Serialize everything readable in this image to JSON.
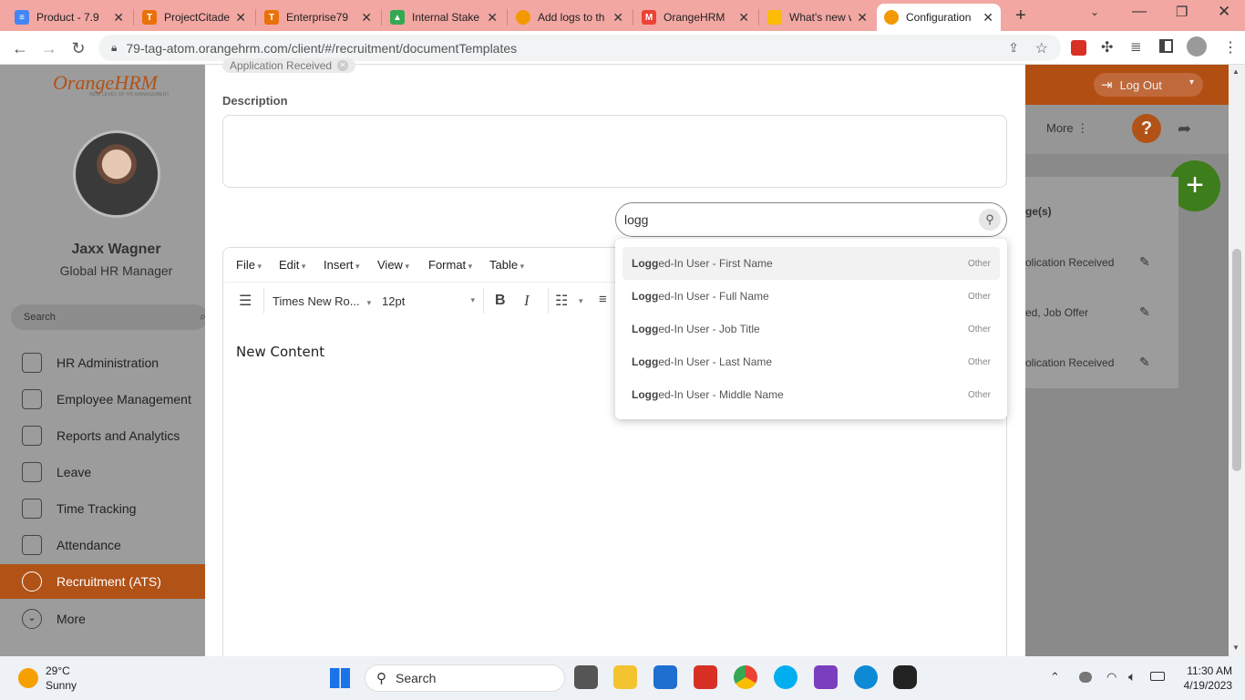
{
  "browser": {
    "tabs": [
      {
        "title": "Product - 7.9",
        "color": "#4285f4",
        "glyph": "≡"
      },
      {
        "title": "ProjectCitade",
        "color": "#e8710a",
        "glyph": "T"
      },
      {
        "title": "Enterprise79",
        "color": "#e8710a",
        "glyph": "T"
      },
      {
        "title": "Internal Stake",
        "color": "#34a853",
        "glyph": "▲"
      },
      {
        "title": "Add logs to th",
        "color": "#f29900",
        "glyph": "●"
      },
      {
        "title": "OrangeHRM",
        "color": "#ea4335",
        "glyph": "M"
      },
      {
        "title": "What's new w",
        "color": "#fbbc04",
        "glyph": "▭"
      },
      {
        "title": "Configuration",
        "color": "#f29900",
        "glyph": "●"
      }
    ],
    "new_tab_symbol": "+",
    "url": "79-tag-atom.orangehrm.com/client/#/recruitment/documentTemplates"
  },
  "sidebar": {
    "logo_text": "OrangeHRM",
    "logo_tagline": "NEW LEVEL OF HR MANAGEMENT",
    "user_name": "Jaxx Wagner",
    "user_role": "Global HR Manager",
    "search_placeholder": "Search",
    "items": [
      {
        "label": "HR Administration"
      },
      {
        "label": "Employee Management"
      },
      {
        "label": "Reports and Analytics"
      },
      {
        "label": "Leave"
      },
      {
        "label": "Time Tracking"
      },
      {
        "label": "Attendance"
      },
      {
        "label": "Recruitment (ATS)"
      },
      {
        "label": "More"
      }
    ]
  },
  "header": {
    "logout_label": "Log Out",
    "more_label": "More",
    "help_symbol": "?",
    "fab_symbol": "+"
  },
  "background_table": {
    "header_fragment": "ge(s)",
    "rows": [
      "olication Received",
      "ed, Job Offer",
      "olication Received"
    ]
  },
  "modal": {
    "chip_label": "Application Received",
    "description_label": "Description",
    "placeholder_search_value": "logg",
    "editor": {
      "menus": [
        "File",
        "Edit",
        "Insert",
        "View",
        "Format",
        "Table"
      ],
      "font_family": "Times New Ro...",
      "font_size": "12pt",
      "content": "New Content"
    },
    "suggestions": [
      {
        "match": "Logg",
        "rest": "ed-In User - First Name",
        "category": "Other"
      },
      {
        "match": "Logg",
        "rest": "ed-In User - Full Name",
        "category": "Other"
      },
      {
        "match": "Logg",
        "rest": "ed-In User - Job Title",
        "category": "Other"
      },
      {
        "match": "Logg",
        "rest": "ed-In User - Last Name",
        "category": "Other"
      },
      {
        "match": "Logg",
        "rest": "ed-In User - Middle Name",
        "category": "Other"
      }
    ]
  },
  "taskbar": {
    "weather_temp": "29°C",
    "weather_desc": "Sunny",
    "search_label": "Search",
    "time": "11:30 AM",
    "date": "4/19/2023"
  },
  "colors": {
    "brand_orange": "#b15217",
    "tab_bar": "#f2a7a2",
    "fab_green": "#3e7d1b"
  }
}
